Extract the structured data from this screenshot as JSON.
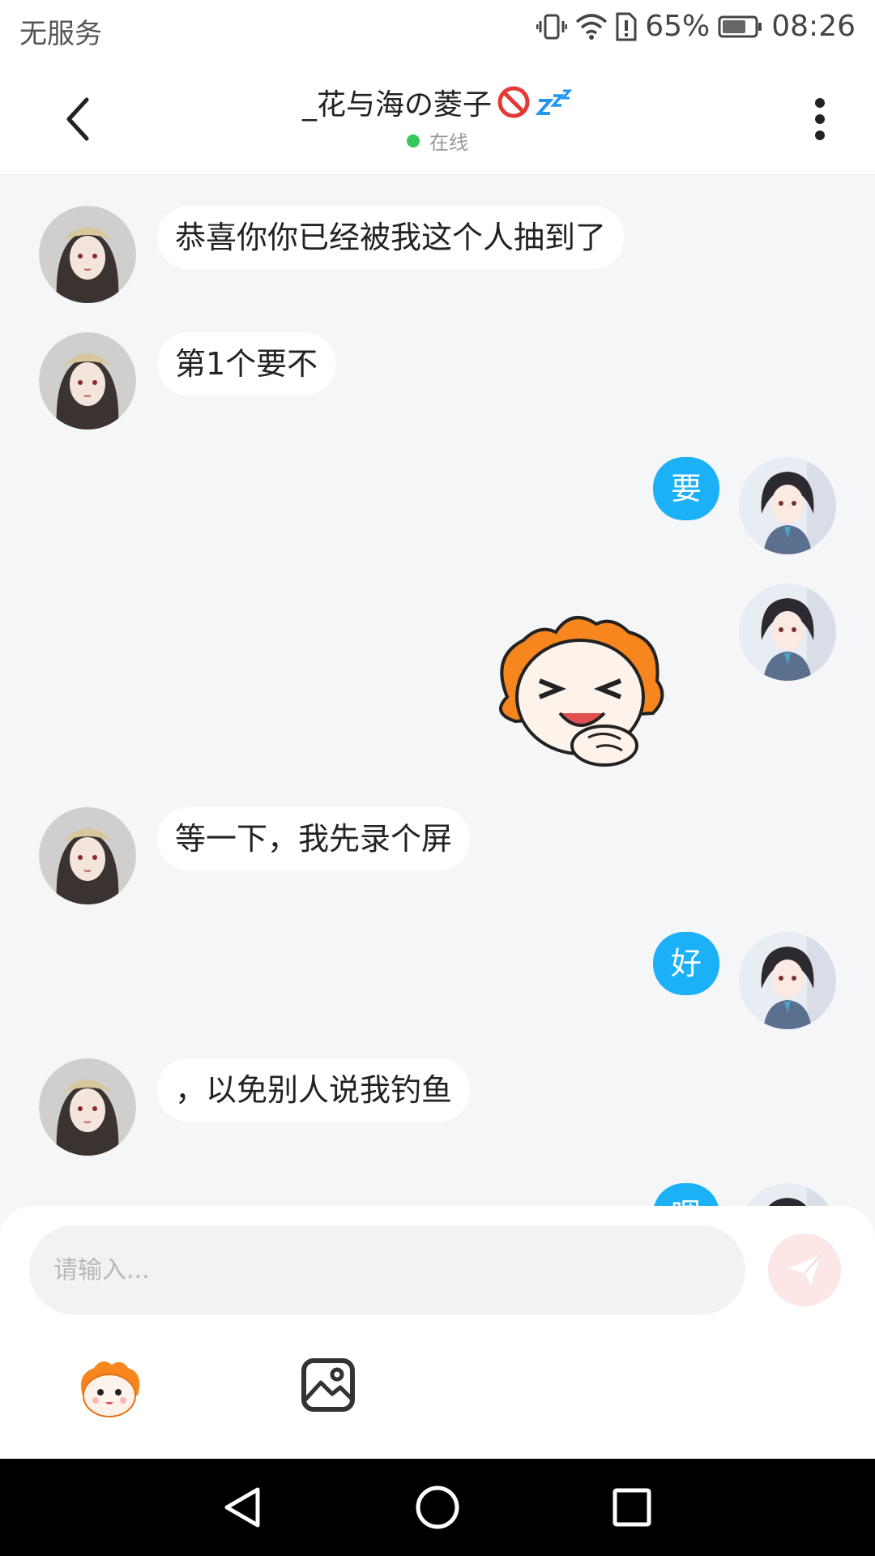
{
  "status_bar": {
    "carrier": "无服务",
    "battery": "65%",
    "time": "08:26"
  },
  "header": {
    "contact_name": "_花与海の菱子",
    "status": "在线",
    "back_icon": "chevron-left-icon",
    "more_icon": "more-vertical-icon"
  },
  "messages": [
    {
      "side": "in",
      "type": "text",
      "text": "恭喜你你已经被我这个人抽到了"
    },
    {
      "side": "in",
      "type": "text",
      "text": "第1个要不"
    },
    {
      "side": "out",
      "type": "text",
      "text": "要"
    },
    {
      "side": "out",
      "type": "sticker",
      "sticker": "laughing-clown-sticker"
    },
    {
      "side": "in",
      "type": "text",
      "text": "等一下，我先录个屏"
    },
    {
      "side": "out",
      "type": "text",
      "text": "好"
    },
    {
      "side": "in",
      "type": "text",
      "text": "，以免别人说我钓鱼"
    },
    {
      "side": "out",
      "type": "text",
      "text": "嗯"
    }
  ],
  "composer": {
    "placeholder": "请输入...",
    "send_icon": "paper-plane-icon",
    "emoji_icon": "sticker-icon",
    "image_icon": "image-icon"
  },
  "colors": {
    "accent": "#1cb0f6",
    "online": "#34c759",
    "send_disabled": "#fde6e6",
    "chat_bg": "#f4f6f8"
  }
}
